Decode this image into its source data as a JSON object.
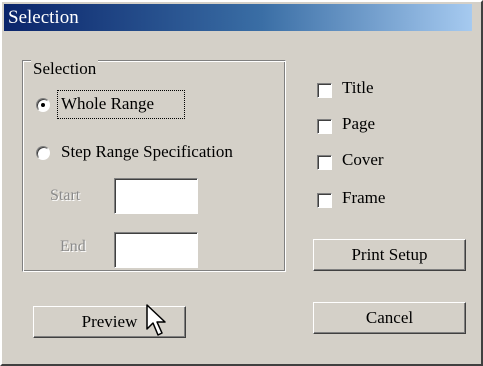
{
  "window": {
    "title": "Selection"
  },
  "group": {
    "legend": "Selection",
    "radios": [
      {
        "label": "Whole Range",
        "checked": true
      },
      {
        "label": "Step Range Specification",
        "checked": false
      }
    ],
    "start_label": "Start",
    "start_value": "",
    "end_label": "End",
    "end_value": ""
  },
  "options": {
    "checkboxes": [
      {
        "label": "Title",
        "checked": false
      },
      {
        "label": "Page",
        "checked": false
      },
      {
        "label": "Cover",
        "checked": false
      },
      {
        "label": "Frame",
        "checked": false
      }
    ]
  },
  "buttons": {
    "print_setup": "Print Setup",
    "preview": "Preview",
    "cancel": "Cancel"
  },
  "colors": {
    "face": "#d4d0c8",
    "title_start": "#0a246a",
    "title_end": "#a6caf0"
  },
  "icons": {
    "cursor": "arrow-cursor-icon"
  }
}
